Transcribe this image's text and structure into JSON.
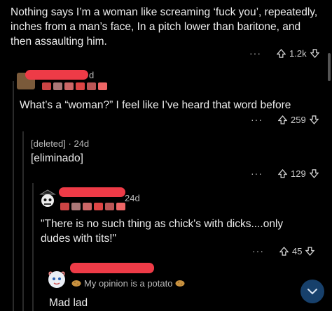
{
  "comments": [
    {
      "text": "Nothing says I’m a woman like screaming ‘fuck you’, repeatedly, inches from a man’s face, In a pitch lower than baritone, and then assaulting him.",
      "more": "···",
      "votes": "1.2k"
    },
    {
      "username_tail": "d",
      "text": "What’s a “woman?” I feel like I’ve heard that word before",
      "more": "···",
      "votes": "259"
    },
    {
      "author": "[deleted]",
      "separator": "·",
      "age": "24d",
      "text": "[eliminado]",
      "more": "···",
      "votes": "129"
    },
    {
      "age": "24d",
      "text": "\"There is no such thing as chick's with dicks....only dudes with tits!\"",
      "more": "···",
      "votes": "45"
    },
    {
      "flair": "My opinion is a potato",
      "text": "Mad lad"
    }
  ],
  "colors": {
    "background": "#000000",
    "redaction": "#ee3b47",
    "fab": "#17406b"
  },
  "icons": [
    "upvote-icon",
    "downvote-icon",
    "more-icon",
    "potato-icon",
    "chevron-down-icon"
  ]
}
